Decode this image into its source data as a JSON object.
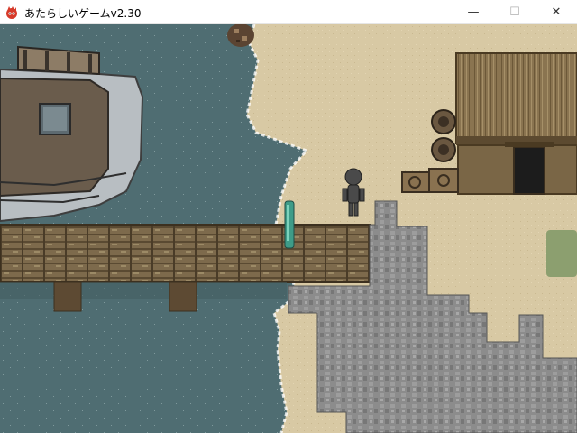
{
  "window": {
    "title": "あたらしいゲームv2.30",
    "controls": {
      "minimize": "—",
      "maximize": "☐",
      "close": "✕"
    }
  },
  "scene": {
    "palette": {
      "sea": "#4f6d72",
      "sand": "#d8c9a4",
      "dock_wood": "#7d6a4c",
      "cobblestone": "#8c8c8c",
      "hut_thatch": "#8a7450",
      "grass": "#8c9f6f"
    },
    "sprites": [
      "boat",
      "wooden-pier",
      "player-character",
      "teal-post",
      "thatched-hut",
      "barrels",
      "stone-path",
      "rock",
      "grass-patch"
    ]
  }
}
